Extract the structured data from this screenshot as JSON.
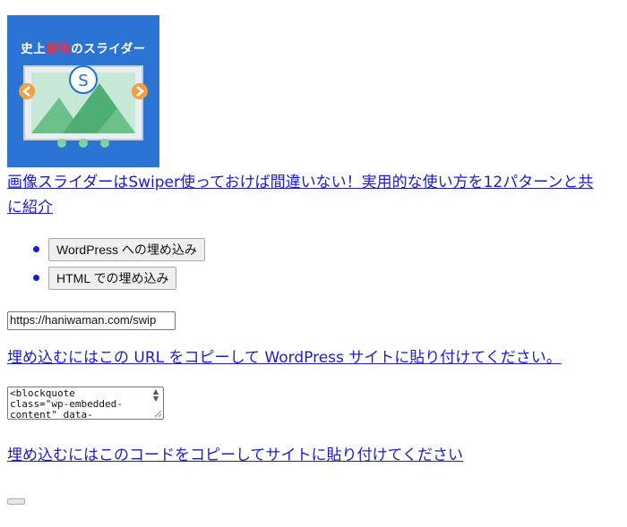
{
  "thumbnail": {
    "title_prefix": "史上",
    "title_accent": "最強",
    "title_suffix": "のスライダー",
    "logo_letter": "S",
    "accent_color": "#e8304a",
    "background_color": "#2b74d3",
    "icons": [
      "slide-image-icon",
      "chevron-left-icon",
      "chevron-right-icon",
      "pagination-dots-icon"
    ]
  },
  "post_link": "画像スライダーはSwiper使っておけば間違いない！実用的な使い方を12パターンと共に紹介",
  "embed_options": [
    {
      "label": "WordPress への埋め込み"
    },
    {
      "label": "HTML での埋め込み"
    }
  ],
  "url_input": {
    "value": "https://haniwaman.com/swip"
  },
  "copy_url_text": "埋め込むにはこの URL をコピーして WordPress サイトに貼り付けてください。",
  "code_area": {
    "value": "<blockquote\nclass=\"wp-embedded-\ncontent\" data-"
  },
  "copy_code_text": "埋め込むにはこのコードをコピーしてサイトに貼り付けてください",
  "link_color": "#1a1ad8"
}
